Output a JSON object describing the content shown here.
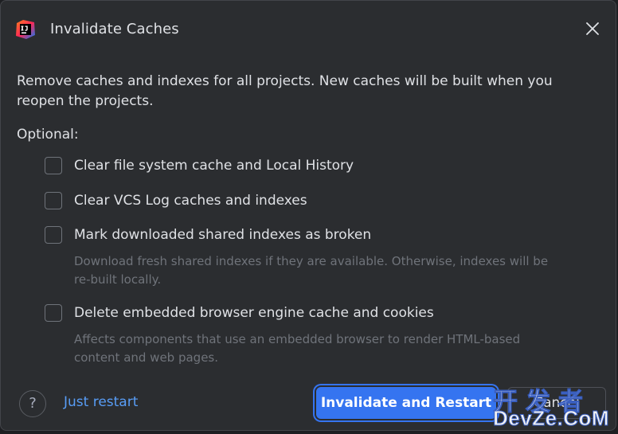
{
  "dialog": {
    "title": "Invalidate Caches",
    "app_icon": "intellij-idea-icon",
    "close_icon": "close-icon"
  },
  "description": "Remove caches and indexes for all projects. New caches will be built when you reopen the projects.",
  "optional_label": "Optional:",
  "options": [
    {
      "label": "Clear file system cache and Local History",
      "checked": false
    },
    {
      "label": "Clear VCS Log caches and indexes",
      "checked": false
    },
    {
      "label": "Mark downloaded shared indexes as broken",
      "checked": false,
      "hint": "Download fresh shared indexes if they are available. Otherwise, indexes will be re-built locally."
    },
    {
      "label": "Delete embedded browser engine cache and cookies",
      "checked": false,
      "hint": "Affects components that use an embedded browser to render HTML-based content and web pages."
    }
  ],
  "footer": {
    "help_label": "?",
    "just_restart_label": "Just restart",
    "primary_label": "Invalidate and Restart",
    "cancel_label": "Cancel"
  },
  "watermark": {
    "line1": "开发者",
    "line2": "DevZe.CoM"
  },
  "colors": {
    "background": "#2b2d30",
    "text": "#dfe1e5",
    "hint_text": "#6f737a",
    "accent": "#3574f0",
    "link": "#589df6"
  }
}
